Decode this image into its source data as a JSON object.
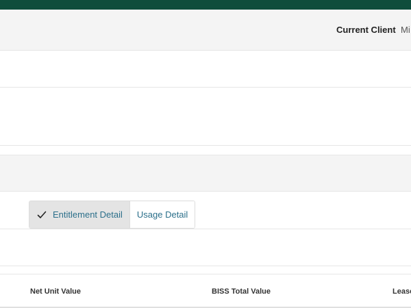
{
  "header": {
    "current_client_label": "Current Client",
    "current_client_value": "Mi"
  },
  "view_toggle": {
    "items": [
      {
        "label": "Entitlement Detail",
        "selected": true
      },
      {
        "label": "Usage Detail",
        "selected": false
      }
    ]
  },
  "table": {
    "columns": [
      {
        "label": "Net Unit Value"
      },
      {
        "label": "BISS Total Value"
      },
      {
        "label": "Lease"
      }
    ]
  },
  "colors": {
    "top_bar": "#0f4d3c",
    "link_text": "#2b6f8a",
    "band_bg": "#f4f4f4"
  },
  "icons": {
    "selected_marker": "check-icon"
  }
}
